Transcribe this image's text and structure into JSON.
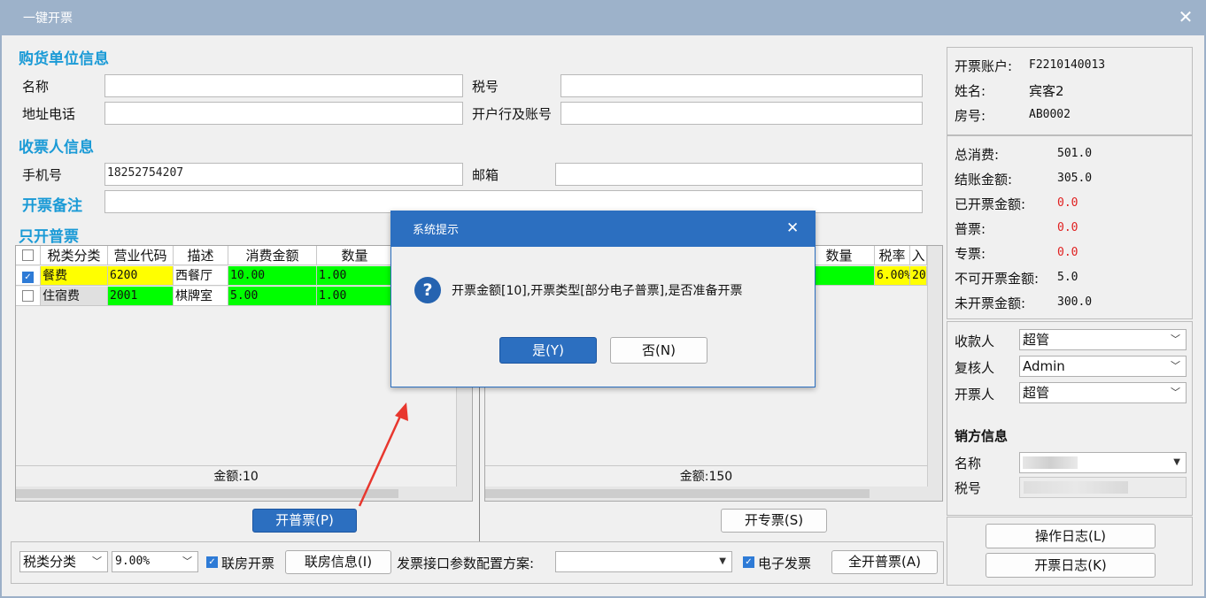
{
  "window": {
    "title": "一键开票"
  },
  "buyer": {
    "section": "购货单位信息",
    "name_label": "名称",
    "name_value": "",
    "tax_label": "税号",
    "tax_value": "",
    "address_label": "地址电话",
    "address_value": "",
    "bank_label": "开户行及账号",
    "bank_value": ""
  },
  "receiver": {
    "section": "收票人信息",
    "phone_label": "手机号",
    "phone_value": "18252754207",
    "email_label": "邮箱",
    "email_value": ""
  },
  "remark": {
    "label": "开票备注",
    "value": ""
  },
  "left_grid": {
    "section": "只开普票",
    "headers": [
      "税类分类",
      "营业代码",
      "描述",
      "消费金额",
      "数量"
    ],
    "rows": [
      {
        "category": "餐费",
        "code": "6200",
        "desc": "西餐厅",
        "amount": "10.00",
        "qty": "1.00",
        "checked": true
      },
      {
        "category": "住宿费",
        "code": "2001",
        "desc": "棋牌室",
        "amount": "5.00",
        "qty": "1.00",
        "checked": false
      }
    ],
    "total": "金额:10",
    "button": "开普票(P)"
  },
  "right_grid": {
    "headers": [
      "数量",
      "税率",
      "入"
    ],
    "row": {
      "rate": "6.00%",
      "extra": "20"
    },
    "total": "金额:150",
    "button": "开专票(S)"
  },
  "info": {
    "account_label": "开票账户:",
    "account": "F2210140013",
    "name_label": "姓名:",
    "name": "宾客2",
    "room_label": "房号:",
    "room": "AB0002"
  },
  "amounts": [
    {
      "label": "总消费:",
      "value": "501.0",
      "red": false
    },
    {
      "label": "结账金额:",
      "value": "305.0",
      "red": false
    },
    {
      "label": "已开票金额:",
      "value": "0.0",
      "red": true
    },
    {
      "label": "普票:",
      "value": "0.0",
      "red": true
    },
    {
      "label": "专票:",
      "value": "0.0",
      "red": true
    },
    {
      "label": "不可开票金额:",
      "value": "5.0",
      "red": false
    },
    {
      "label": "未开票金额:",
      "value": "300.0",
      "red": false
    }
  ],
  "staff": {
    "payee_label": "收款人",
    "payee": "超管",
    "reviewer_label": "复核人",
    "reviewer": "Admin",
    "drawer_label": "开票人",
    "drawer": "超管"
  },
  "seller": {
    "section": "销方信息",
    "name_label": "名称",
    "tax_label": "税号"
  },
  "logs": {
    "op_log": "操作日志(L)",
    "invoice_log": "开票日志(K)"
  },
  "bottom": {
    "category": "税类分类",
    "rate": "9.00%",
    "linked_label": "联房开票",
    "linked_info_btn": "联房信息(I)",
    "config_label": "发票接口参数配置方案:",
    "config_value": "",
    "einvoice_label": "电子发票",
    "all_btn": "全开普票(A)"
  },
  "dialog": {
    "title": "系统提示",
    "message": "开票金额[10],开票类型[部分电子普票],是否准备开票",
    "yes": "是(Y)",
    "no": "否(N)"
  },
  "colors": {
    "accent": "#1a9ad6",
    "dialog_header": "#2c6fc0",
    "highlight_yellow": "#ffff00",
    "highlight_green": "#00ff00",
    "annotation_arrow": "#e8372e"
  }
}
